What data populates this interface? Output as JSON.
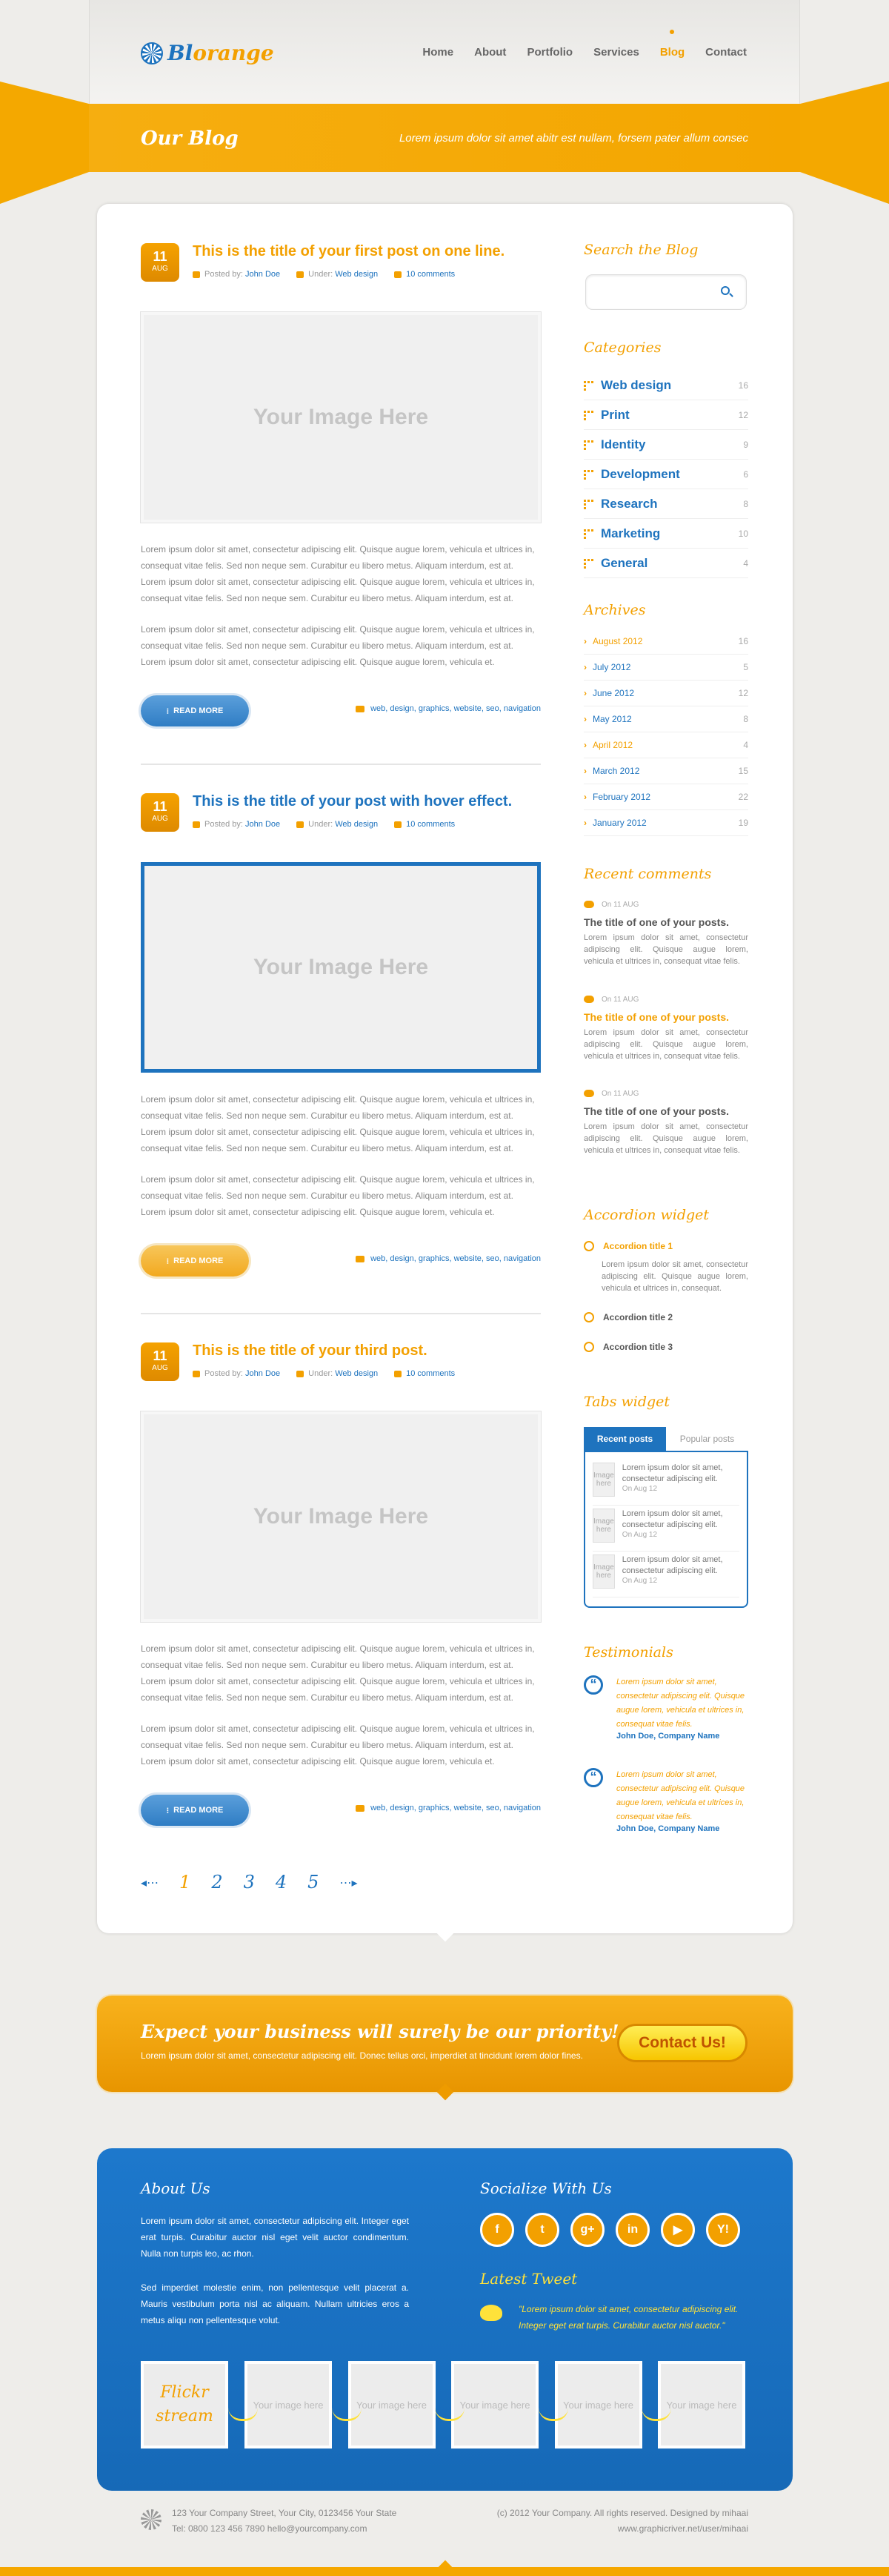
{
  "brand": {
    "logo_main": "Bl",
    "logo_accent": "orange"
  },
  "nav": {
    "items": [
      "Home",
      "About",
      "Portfolio",
      "Services",
      "Blog",
      "Contact"
    ],
    "active": "Blog"
  },
  "banner": {
    "title": "Our Blog",
    "text": "Lorem ipsum dolor sit amet abitr est nullam, forsem pater allum consec"
  },
  "posts": [
    {
      "day": "11",
      "month": "AUG",
      "title": "This is the title of your first post on one line.",
      "posted_label": "Posted by:",
      "author": "John Doe",
      "under_label": "Under:",
      "category": "Web design",
      "comments": "10 comments",
      "image": "Your Image Here",
      "para1": "Lorem ipsum dolor sit amet, consectetur adipiscing elit. Quisque augue lorem, vehicula et ultrices in, consequat vitae felis. Sed non neque sem. Curabitur eu libero metus. Aliquam interdum, est at. Lorem ipsum dolor sit amet, consectetur adipiscing elit. Quisque augue lorem, vehicula et ultrices in, consequat vitae felis. Sed non neque sem. Curabitur eu libero metus. Aliquam interdum, est at.",
      "para2": "Lorem ipsum dolor sit amet, consectetur adipiscing elit. Quisque augue lorem, vehicula et ultrices in, consequat vitae felis. Sed non neque sem. Curabitur eu libero metus. Aliquam interdum, est at. Lorem ipsum dolor sit amet, consectetur adipiscing elit. Quisque augue lorem, vehicula et.",
      "readmore": "READ MORE",
      "tags": "web, design, graphics, website, seo, navigation"
    },
    {
      "day": "11",
      "month": "AUG",
      "title": "This is the title of your post with hover effect.",
      "posted_label": "Posted by:",
      "author": "John Doe",
      "under_label": "Under:",
      "category": "Web design",
      "comments": "10 comments",
      "image": "Your Image Here",
      "para1": "Lorem ipsum dolor sit amet, consectetur adipiscing elit. Quisque augue lorem, vehicula et ultrices in, consequat vitae felis. Sed non neque sem. Curabitur eu libero metus. Aliquam interdum, est at. Lorem ipsum dolor sit amet, consectetur adipiscing elit. Quisque augue lorem, vehicula et ultrices in, consequat vitae felis. Sed non neque sem. Curabitur eu libero metus. Aliquam interdum, est at.",
      "para2": "Lorem ipsum dolor sit amet, consectetur adipiscing elit. Quisque augue lorem, vehicula et ultrices in, consequat vitae felis. Sed non neque sem. Curabitur eu libero metus. Aliquam interdum, est at. Lorem ipsum dolor sit amet, consectetur adipiscing elit. Quisque augue lorem, vehicula et.",
      "readmore": "READ MORE",
      "tags": "web, design, graphics, website, seo, navigation"
    },
    {
      "day": "11",
      "month": "AUG",
      "title": "This is the title of your third post.",
      "posted_label": "Posted by:",
      "author": "John Doe",
      "under_label": "Under:",
      "category": "Web design",
      "comments": "10 comments",
      "image": "Your Image Here",
      "para1": "Lorem ipsum dolor sit amet, consectetur adipiscing elit. Quisque augue lorem, vehicula et ultrices in, consequat vitae felis. Sed non neque sem. Curabitur eu libero metus. Aliquam interdum, est at. Lorem ipsum dolor sit amet, consectetur adipiscing elit. Quisque augue lorem, vehicula et ultrices in, consequat vitae felis. Sed non neque sem. Curabitur eu libero metus. Aliquam interdum, est at.",
      "para2": "Lorem ipsum dolor sit amet, consectetur adipiscing elit. Quisque augue lorem, vehicula et ultrices in, consequat vitae felis. Sed non neque sem. Curabitur eu libero metus. Aliquam interdum, est at. Lorem ipsum dolor sit amet, consectetur adipiscing elit. Quisque augue lorem, vehicula et.",
      "readmore": "READ MORE",
      "tags": "web, design, graphics, website, seo, navigation"
    }
  ],
  "pagination": {
    "pages": [
      "1",
      "2",
      "3",
      "4",
      "5"
    ],
    "current": "1"
  },
  "sidebar": {
    "search_title": "Search the Blog",
    "categories_title": "Categories",
    "categories": [
      {
        "name": "Web design",
        "count": "16"
      },
      {
        "name": "Print",
        "count": "12"
      },
      {
        "name": "Identity",
        "count": "9"
      },
      {
        "name": "Development",
        "count": "6"
      },
      {
        "name": "Research",
        "count": "8"
      },
      {
        "name": "Marketing",
        "count": "10"
      },
      {
        "name": "General",
        "count": "4"
      }
    ],
    "archives_title": "Archives",
    "archives": [
      {
        "name": "August 2012",
        "count": "16"
      },
      {
        "name": "July 2012",
        "count": "5"
      },
      {
        "name": "June 2012",
        "count": "12"
      },
      {
        "name": "May 2012",
        "count": "8"
      },
      {
        "name": "April 2012",
        "count": "4"
      },
      {
        "name": "March 2012",
        "count": "15"
      },
      {
        "name": "February 2012",
        "count": "22"
      },
      {
        "name": "January 2012",
        "count": "19"
      }
    ],
    "comments_title": "Recent comments",
    "comments": [
      {
        "date": "On 11 AUG",
        "title": "The title of one of your posts.",
        "text": "Lorem ipsum dolor sit amet, consectetur adipiscing elit. Quisque augue lorem, vehicula et ultrices in, consequat vitae felis."
      },
      {
        "date": "On 11 AUG",
        "title": "The title of one of your posts.",
        "text": "Lorem ipsum dolor sit amet, consectetur adipiscing elit. Quisque augue lorem, vehicula et ultrices in, consequat vitae felis."
      },
      {
        "date": "On 11 AUG",
        "title": "The title of one of your posts.",
        "text": "Lorem ipsum dolor sit amet, consectetur adipiscing elit. Quisque augue lorem, vehicula et ultrices in, consequat vitae felis."
      }
    ],
    "accordion_title": "Accordion widget",
    "accordion": [
      {
        "title": "Accordion title 1",
        "body": "Lorem ipsum dolor sit amet, consectetur adipiscing elit. Quisque augue lorem, vehicula et ultrices in, consequat."
      },
      {
        "title": "Accordion title 2"
      },
      {
        "title": "Accordion title 3"
      }
    ],
    "tabs_title": "Tabs widget",
    "tabs": [
      "Recent posts",
      "Popular posts"
    ],
    "tab_posts": [
      {
        "thumb": "Image here",
        "text": "Lorem ipsum dolor sit amet, consectetur adipiscing elit.",
        "date": "On Aug 12"
      },
      {
        "thumb": "Image here",
        "text": "Lorem ipsum dolor sit amet, consectetur adipiscing elit.",
        "date": "On Aug 12"
      },
      {
        "thumb": "Image here",
        "text": "Lorem ipsum dolor sit amet, consectetur adipiscing elit.",
        "date": "On Aug 12"
      }
    ],
    "testimonials_title": "Testimonials",
    "testimonials": [
      {
        "text": "Lorem ipsum dolor sit amet, consectetur adipiscing elit. Quisque augue lorem, vehicula et ultrices in, consequat vitae felis.",
        "author": "John Doe, Company Name"
      },
      {
        "text": "Lorem ipsum dolor sit amet, consectetur adipiscing elit. Quisque augue lorem, vehicula et ultrices in, consequat vitae felis.",
        "author": "John Doe, Company Name"
      }
    ]
  },
  "cta": {
    "title": "Expect your business will surely be our priority!",
    "text": "Lorem ipsum dolor sit amet, consectetur adipiscing elit. Donec tellus orci, imperdiet at tincidunt lorem dolor fines.",
    "button": "Contact Us!"
  },
  "footer": {
    "about_title": "About Us",
    "about_p1": "Lorem ipsum dolor sit amet, consectetur adipiscing elit. Integer eget erat turpis. Curabitur auctor nisl eget velit auctor condimentum. Nulla non turpis leo, ac rhon.",
    "about_p2": "Sed imperdiet molestie enim, non pellentesque velit placerat a. Mauris vestibulum porta nisl ac aliquam. Nullam ultricies eros a metus aliqu non pellentesque volut.",
    "social_title": "Socialize With Us",
    "social": [
      "f",
      "t",
      "g+",
      "in",
      "▶",
      "Y!"
    ],
    "tweet_title": "Latest Tweet",
    "tweet": "\"Lorem ipsum dolor sit amet, consectetur adipiscing elit. Integer eget erat turpis. Curabitur auctor nisl auctor.\"",
    "flickr_label": "Flickr stream",
    "flickr_items": [
      "Your image here",
      "Your image here",
      "Your image here",
      "Your image here",
      "Your image here"
    ]
  },
  "bottom": {
    "address": "123 Your Company Street, Your City, 0123456 Your State",
    "contact": "Tel: 0800 123 456 7890     hello@yourcompany.com",
    "copyright": "(c) 2012 Your Company. All rights reserved. Designed by mihaai",
    "credit": "www.graphicriver.net/user/mihaai"
  },
  "colors": {
    "orange": "#f3a000",
    "blue": "#1e73be"
  }
}
